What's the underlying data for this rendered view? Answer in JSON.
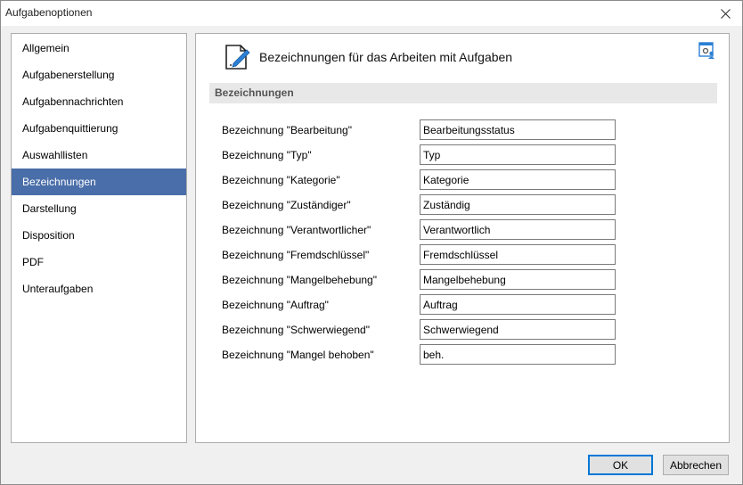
{
  "window": {
    "title": "Aufgabenoptionen"
  },
  "sidebar": {
    "items": [
      {
        "label": "Allgemein",
        "active": false
      },
      {
        "label": "Aufgabenerstellung",
        "active": false
      },
      {
        "label": "Aufgabennachrichten",
        "active": false
      },
      {
        "label": "Aufgabenquittierung",
        "active": false
      },
      {
        "label": "Auswahllisten",
        "active": false
      },
      {
        "label": "Bezeichnungen",
        "active": true
      },
      {
        "label": "Darstellung",
        "active": false
      },
      {
        "label": "Disposition",
        "active": false
      },
      {
        "label": "PDF",
        "active": false
      },
      {
        "label": "Unteraufgaben",
        "active": false
      }
    ]
  },
  "content": {
    "header_title": "Bezeichnungen für das Arbeiten mit Aufgaben",
    "header_icon": "document-edit-icon",
    "corner_icon": "settings-user-icon",
    "section_title": "Bezeichnungen",
    "rows": [
      {
        "label": "Bezeichnung \"Bearbeitung\"",
        "value": "Bearbeitungsstatus"
      },
      {
        "label": "Bezeichnung \"Typ\"",
        "value": "Typ"
      },
      {
        "label": "Bezeichnung \"Kategorie\"",
        "value": "Kategorie"
      },
      {
        "label": "Bezeichnung \"Zuständiger\"",
        "value": "Zuständig"
      },
      {
        "label": "Bezeichnung \"Verantwortlicher\"",
        "value": "Verantwortlich"
      },
      {
        "label": "Bezeichnung \"Fremdschlüssel\"",
        "value": "Fremdschlüssel"
      },
      {
        "label": "Bezeichnung \"Mangelbehebung\"",
        "value": "Mangelbehebung"
      },
      {
        "label": "Bezeichnung \"Auftrag\"",
        "value": "Auftrag"
      },
      {
        "label": "Bezeichnung \"Schwerwiegend\"",
        "value": "Schwerwiegend"
      },
      {
        "label": "Bezeichnung \"Mangel behoben\"",
        "value": "beh."
      }
    ]
  },
  "buttons": {
    "ok": "OK",
    "cancel": "Abbrechen"
  },
  "colors": {
    "selection": "#4a6ea9",
    "accent": "#0078d7",
    "icon_blue": "#2b7fd4"
  }
}
